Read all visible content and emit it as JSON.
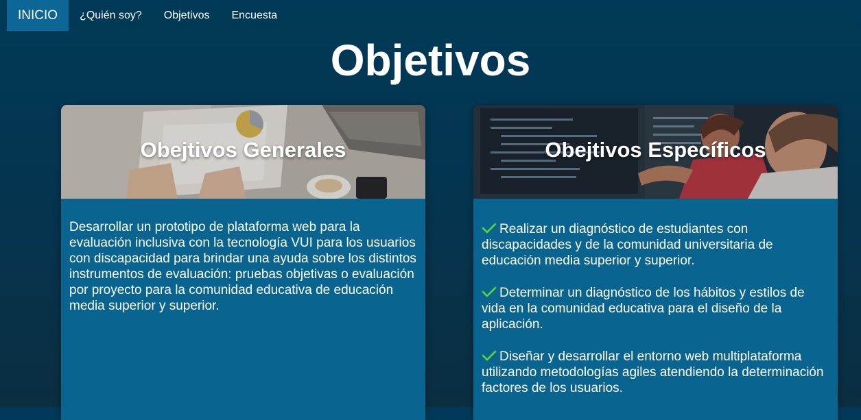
{
  "nav": {
    "items": [
      {
        "label": "INICIO",
        "active": true
      },
      {
        "label": "¿Quién soy?",
        "active": false
      },
      {
        "label": "Objetivos",
        "active": false
      },
      {
        "label": "Encuesta",
        "active": false
      }
    ]
  },
  "page": {
    "title": "Objetivos"
  },
  "cards": {
    "general": {
      "title": "Obejtivos Generales",
      "text": "Desarrollar un prototipo de plataforma web para la evaluación inclusiva con la tecnología VUI para los usuarios con discapacidad para brindar una ayuda sobre los distintos instrumentos de evaluación: pruebas objetivas o evaluación por proyecto para la comunidad educativa de educación media superior y superior."
    },
    "specific": {
      "title": "Obejtivos Específicos",
      "items": [
        "Realizar un diagnóstico de estudiantes con discapacidades y de la comunidad universitaria de educación media superior y superior.",
        "Determinar un diagnóstico de los hábitos y estilos de vida en la comunidad educativa para el diseño de la aplicación.",
        "Diseñar y desarrollar el entorno web multiplataforma utilizando metodologías agiles atendiendo la determinación factores de los usuarios."
      ]
    }
  },
  "colors": {
    "background": "#003a58",
    "active_nav": "#0d6796",
    "card_body": "#0a6490",
    "check": "#3fbf3f"
  },
  "icons": {
    "list_marker": "check-mark-icon"
  }
}
